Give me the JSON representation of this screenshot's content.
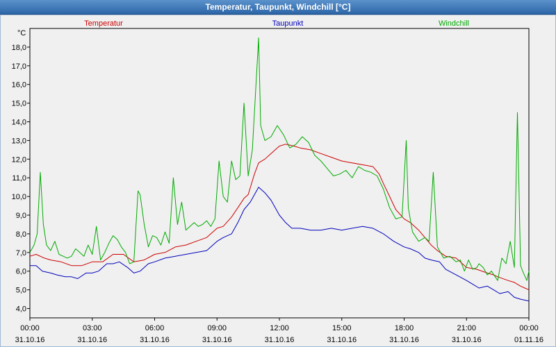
{
  "window": {
    "title": "Temperatur, Taupunkt, Windchill [°C]"
  },
  "chart_data": {
    "type": "line",
    "title": "Temperatur, Taupunkt, Windchill [°C]",
    "ylabel": "°C",
    "ylim": [
      3.5,
      19.0
    ],
    "xlim_hours": [
      0,
      24
    ],
    "grid": true,
    "y_ticks": [
      "4,0",
      "5,0",
      "6,0",
      "7,0",
      "8,0",
      "9,0",
      "10,0",
      "11,0",
      "12,0",
      "13,0",
      "14,0",
      "15,0",
      "16,0",
      "17,0",
      "18,0"
    ],
    "x_ticks": [
      {
        "time": "00:00",
        "date": "31.10.16"
      },
      {
        "time": "03:00",
        "date": "31.10.16"
      },
      {
        "time": "06:00",
        "date": "31.10.16"
      },
      {
        "time": "09:00",
        "date": "31.10.16"
      },
      {
        "time": "12:00",
        "date": "31.10.16"
      },
      {
        "time": "15:00",
        "date": "31.10.16"
      },
      {
        "time": "18:00",
        "date": "31.10.16"
      },
      {
        "time": "21:00",
        "date": "31.10.16"
      },
      {
        "time": "00:00",
        "date": "01.11.16"
      }
    ],
    "series": [
      {
        "name": "Temperatur",
        "color": "#cc0000",
        "points": [
          [
            0,
            6.8
          ],
          [
            0.3,
            6.9
          ],
          [
            0.7,
            6.7
          ],
          [
            1.0,
            6.6
          ],
          [
            1.5,
            6.5
          ],
          [
            2.0,
            6.3
          ],
          [
            2.5,
            6.3
          ],
          [
            3.0,
            6.5
          ],
          [
            3.5,
            6.5
          ],
          [
            4.0,
            6.9
          ],
          [
            4.5,
            6.9
          ],
          [
            5.0,
            6.5
          ],
          [
            5.5,
            6.6
          ],
          [
            6.0,
            6.9
          ],
          [
            6.5,
            7.0
          ],
          [
            7.0,
            7.3
          ],
          [
            7.5,
            7.4
          ],
          [
            8.0,
            7.6
          ],
          [
            8.5,
            7.8
          ],
          [
            9.0,
            8.3
          ],
          [
            9.3,
            8.4
          ],
          [
            9.7,
            8.9
          ],
          [
            10.0,
            9.4
          ],
          [
            10.3,
            9.9
          ],
          [
            10.5,
            10.1
          ],
          [
            10.8,
            11.2
          ],
          [
            11.0,
            11.8
          ],
          [
            11.3,
            12.0
          ],
          [
            11.6,
            12.3
          ],
          [
            12.0,
            12.7
          ],
          [
            12.3,
            12.8
          ],
          [
            12.7,
            12.7
          ],
          [
            13.0,
            12.6
          ],
          [
            13.5,
            12.5
          ],
          [
            14.0,
            12.3
          ],
          [
            14.5,
            12.1
          ],
          [
            15.0,
            11.9
          ],
          [
            15.5,
            11.8
          ],
          [
            16.0,
            11.7
          ],
          [
            16.5,
            11.6
          ],
          [
            16.8,
            11.2
          ],
          [
            17.0,
            10.7
          ],
          [
            17.3,
            10.0
          ],
          [
            17.6,
            9.3
          ],
          [
            18.0,
            8.8
          ],
          [
            18.3,
            8.6
          ],
          [
            18.7,
            8.2
          ],
          [
            19.0,
            7.8
          ],
          [
            19.3,
            7.4
          ],
          [
            19.6,
            7.1
          ],
          [
            20.0,
            6.8
          ],
          [
            20.5,
            6.7
          ],
          [
            21.0,
            6.2
          ],
          [
            21.5,
            6.1
          ],
          [
            22.0,
            5.9
          ],
          [
            22.3,
            5.8
          ],
          [
            22.5,
            5.7
          ],
          [
            23.0,
            5.5
          ],
          [
            23.3,
            5.4
          ],
          [
            23.6,
            5.2
          ],
          [
            23.8,
            5.1
          ],
          [
            24.0,
            5.0
          ]
        ]
      },
      {
        "name": "Taupunkt",
        "color": "#0000bb",
        "points": [
          [
            0,
            6.3
          ],
          [
            0.3,
            6.3
          ],
          [
            0.6,
            6.0
          ],
          [
            1.0,
            5.9
          ],
          [
            1.3,
            5.8
          ],
          [
            1.7,
            5.7
          ],
          [
            2.0,
            5.7
          ],
          [
            2.3,
            5.6
          ],
          [
            2.7,
            5.9
          ],
          [
            3.0,
            5.9
          ],
          [
            3.3,
            6.0
          ],
          [
            3.7,
            6.4
          ],
          [
            4.0,
            6.4
          ],
          [
            4.3,
            6.5
          ],
          [
            4.7,
            6.2
          ],
          [
            5.0,
            5.9
          ],
          [
            5.3,
            6.0
          ],
          [
            5.7,
            6.4
          ],
          [
            6.0,
            6.5
          ],
          [
            6.5,
            6.7
          ],
          [
            7.0,
            6.8
          ],
          [
            7.5,
            6.9
          ],
          [
            8.0,
            7.0
          ],
          [
            8.5,
            7.1
          ],
          [
            9.0,
            7.6
          ],
          [
            9.3,
            7.8
          ],
          [
            9.7,
            8.0
          ],
          [
            10.0,
            8.6
          ],
          [
            10.3,
            9.3
          ],
          [
            10.6,
            9.7
          ],
          [
            11.0,
            10.5
          ],
          [
            11.3,
            10.2
          ],
          [
            11.6,
            9.8
          ],
          [
            12.0,
            9.0
          ],
          [
            12.3,
            8.6
          ],
          [
            12.6,
            8.3
          ],
          [
            13.0,
            8.3
          ],
          [
            13.5,
            8.2
          ],
          [
            14.0,
            8.2
          ],
          [
            14.5,
            8.3
          ],
          [
            15.0,
            8.2
          ],
          [
            15.5,
            8.3
          ],
          [
            16.0,
            8.4
          ],
          [
            16.5,
            8.3
          ],
          [
            17.0,
            8.0
          ],
          [
            17.5,
            7.6
          ],
          [
            18.0,
            7.3
          ],
          [
            18.3,
            7.2
          ],
          [
            18.7,
            7.0
          ],
          [
            19.0,
            6.7
          ],
          [
            19.3,
            6.6
          ],
          [
            19.7,
            6.5
          ],
          [
            20.0,
            6.1
          ],
          [
            20.5,
            5.8
          ],
          [
            21.0,
            5.5
          ],
          [
            21.3,
            5.3
          ],
          [
            21.6,
            5.1
          ],
          [
            22.0,
            5.2
          ],
          [
            22.3,
            5.0
          ],
          [
            22.6,
            4.8
          ],
          [
            23.0,
            4.9
          ],
          [
            23.3,
            4.6
          ],
          [
            23.6,
            4.5
          ],
          [
            24.0,
            4.4
          ]
        ]
      },
      {
        "name": "Windchill",
        "color": "#00aa00",
        "points": [
          [
            0,
            7.0
          ],
          [
            0.2,
            7.4
          ],
          [
            0.35,
            8.0
          ],
          [
            0.5,
            11.3
          ],
          [
            0.65,
            8.5
          ],
          [
            0.8,
            7.4
          ],
          [
            1.0,
            7.1
          ],
          [
            1.2,
            7.6
          ],
          [
            1.4,
            6.9
          ],
          [
            1.6,
            6.8
          ],
          [
            1.8,
            6.7
          ],
          [
            2.0,
            6.8
          ],
          [
            2.2,
            7.2
          ],
          [
            2.4,
            7.0
          ],
          [
            2.6,
            6.8
          ],
          [
            2.8,
            7.4
          ],
          [
            3.0,
            6.9
          ],
          [
            3.2,
            8.4
          ],
          [
            3.4,
            6.6
          ],
          [
            3.6,
            7.0
          ],
          [
            3.8,
            7.5
          ],
          [
            4.0,
            7.9
          ],
          [
            4.2,
            7.7
          ],
          [
            4.4,
            7.3
          ],
          [
            4.6,
            7.0
          ],
          [
            4.8,
            6.4
          ],
          [
            5.0,
            6.5
          ],
          [
            5.2,
            10.3
          ],
          [
            5.3,
            10.1
          ],
          [
            5.5,
            8.5
          ],
          [
            5.7,
            7.3
          ],
          [
            5.9,
            7.9
          ],
          [
            6.1,
            7.8
          ],
          [
            6.3,
            7.4
          ],
          [
            6.5,
            8.1
          ],
          [
            6.7,
            7.5
          ],
          [
            6.9,
            11.0
          ],
          [
            7.1,
            8.5
          ],
          [
            7.3,
            9.7
          ],
          [
            7.5,
            8.2
          ],
          [
            7.7,
            8.4
          ],
          [
            7.9,
            8.6
          ],
          [
            8.1,
            8.4
          ],
          [
            8.3,
            8.5
          ],
          [
            8.5,
            8.7
          ],
          [
            8.7,
            8.4
          ],
          [
            8.9,
            8.8
          ],
          [
            9.1,
            11.9
          ],
          [
            9.3,
            10.0
          ],
          [
            9.5,
            9.7
          ],
          [
            9.7,
            11.9
          ],
          [
            9.9,
            10.9
          ],
          [
            10.1,
            11.1
          ],
          [
            10.3,
            15.0
          ],
          [
            10.5,
            11.1
          ],
          [
            10.7,
            12.5
          ],
          [
            11.0,
            18.5
          ],
          [
            11.1,
            13.8
          ],
          [
            11.3,
            13.0
          ],
          [
            11.6,
            13.2
          ],
          [
            11.9,
            13.8
          ],
          [
            12.2,
            13.3
          ],
          [
            12.5,
            12.6
          ],
          [
            12.8,
            12.8
          ],
          [
            13.1,
            13.2
          ],
          [
            13.4,
            12.9
          ],
          [
            13.7,
            12.2
          ],
          [
            14.0,
            11.9
          ],
          [
            14.3,
            11.5
          ],
          [
            14.6,
            11.1
          ],
          [
            14.9,
            11.2
          ],
          [
            15.2,
            11.4
          ],
          [
            15.5,
            11.0
          ],
          [
            15.8,
            11.6
          ],
          [
            16.1,
            11.4
          ],
          [
            16.4,
            11.3
          ],
          [
            16.7,
            11.1
          ],
          [
            17.0,
            10.4
          ],
          [
            17.3,
            9.4
          ],
          [
            17.6,
            8.8
          ],
          [
            17.9,
            8.9
          ],
          [
            18.1,
            13.0
          ],
          [
            18.2,
            9.4
          ],
          [
            18.4,
            8.1
          ],
          [
            18.7,
            7.6
          ],
          [
            19.0,
            7.8
          ],
          [
            19.2,
            7.6
          ],
          [
            19.4,
            11.3
          ],
          [
            19.6,
            7.3
          ],
          [
            19.9,
            6.7
          ],
          [
            20.2,
            6.8
          ],
          [
            20.5,
            6.5
          ],
          [
            20.7,
            6.6
          ],
          [
            20.9,
            6.0
          ],
          [
            21.1,
            6.6
          ],
          [
            21.3,
            6.1
          ],
          [
            21.5,
            6.2
          ],
          [
            21.6,
            6.4
          ],
          [
            21.8,
            6.2
          ],
          [
            22.0,
            5.8
          ],
          [
            22.2,
            6.0
          ],
          [
            22.5,
            5.5
          ],
          [
            22.7,
            6.7
          ],
          [
            22.9,
            6.4
          ],
          [
            23.1,
            7.6
          ],
          [
            23.3,
            6.2
          ],
          [
            23.45,
            14.5
          ],
          [
            23.6,
            6.3
          ],
          [
            23.7,
            6.0
          ],
          [
            23.9,
            5.5
          ],
          [
            24.0,
            6.0
          ]
        ]
      }
    ]
  }
}
